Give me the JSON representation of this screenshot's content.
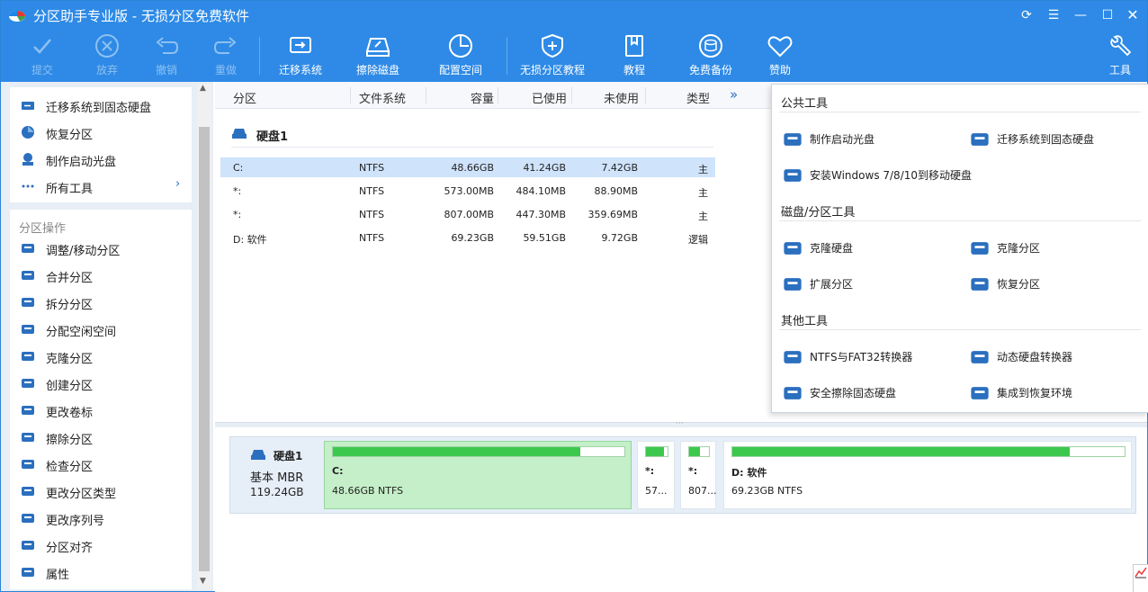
{
  "window": {
    "title": "分区助手专业版 - 无损分区免费软件"
  },
  "toolbar": {
    "commit": "提交",
    "discard": "放弃",
    "undo": "撤销",
    "redo": "重做",
    "migrate_os": "迁移系统",
    "wipe_disk": "擦除磁盘",
    "allocate_space": "配置空间",
    "tutorial_lossless": "无损分区教程",
    "tutorial": "教程",
    "free_backup": "免费备份",
    "sponsor": "赞助",
    "tools": "工具"
  },
  "sidebar": {
    "top_items": [
      {
        "label": "迁移系统到固态硬盘",
        "icon": "ssd-migrate-icon"
      },
      {
        "label": "恢复分区",
        "icon": "recover-partition-icon"
      },
      {
        "label": "制作启动光盘",
        "icon": "boot-disc-icon"
      },
      {
        "label": "所有工具",
        "icon": "all-tools-icon"
      }
    ],
    "ops_heading": "分区操作",
    "ops": [
      {
        "label": "调整/移动分区",
        "icon": "resize-move-icon"
      },
      {
        "label": "合并分区",
        "icon": "merge-icon"
      },
      {
        "label": "拆分分区",
        "icon": "split-icon"
      },
      {
        "label": "分配空闲空间",
        "icon": "allocate-free-icon"
      },
      {
        "label": "克隆分区",
        "icon": "clone-partition-icon"
      },
      {
        "label": "创建分区",
        "icon": "create-partition-icon"
      },
      {
        "label": "更改卷标",
        "icon": "change-label-icon"
      },
      {
        "label": "擦除分区",
        "icon": "wipe-partition-icon"
      },
      {
        "label": "检查分区",
        "icon": "check-partition-icon"
      },
      {
        "label": "更改分区类型",
        "icon": "id-icon"
      },
      {
        "label": "更改序列号",
        "icon": "serial-icon"
      },
      {
        "label": "分区对齐",
        "icon": "align-icon"
      },
      {
        "label": "属性",
        "icon": "info-icon"
      }
    ]
  },
  "table": {
    "headers": {
      "partition": "分区",
      "fs": "文件系统",
      "capacity": "容量",
      "used": "已使用",
      "unused": "未使用",
      "type": "类型",
      "more": "»"
    },
    "disk_label": "硬盘1",
    "rows": [
      {
        "partition": "C:",
        "fs": "NTFS",
        "capacity": "48.66GB",
        "used": "41.24GB",
        "unused": "7.42GB",
        "type": "主"
      },
      {
        "partition": "*:",
        "fs": "NTFS",
        "capacity": "573.00MB",
        "used": "484.10MB",
        "unused": "88.90MB",
        "type": "主"
      },
      {
        "partition": "*:",
        "fs": "NTFS",
        "capacity": "807.00MB",
        "used": "447.30MB",
        "unused": "359.69MB",
        "type": "主"
      },
      {
        "partition": "D: 软件",
        "fs": "NTFS",
        "capacity": "69.23GB",
        "used": "59.51GB",
        "unused": "9.72GB",
        "type": "逻辑"
      }
    ]
  },
  "diskmap": {
    "disk_name": "硬盘1",
    "disk_type": "基本 MBR",
    "disk_size": "119.24GB",
    "parts": [
      {
        "name": "C:",
        "sub": "48.66GB NTFS",
        "used_fraction": 0.85
      },
      {
        "name": "*:",
        "sub": "57...",
        "used_fraction": 0.85
      },
      {
        "name": "*:",
        "sub": "807...",
        "used_fraction": 0.55
      },
      {
        "name": "D: 软件",
        "sub": "69.23GB NTFS",
        "used_fraction": 0.86
      }
    ]
  },
  "tools_panel": {
    "public_heading": "公共工具",
    "public": [
      {
        "label": "制作启动光盘",
        "icon": "boot-disc-icon"
      },
      {
        "label": "迁移系统到固态硬盘",
        "icon": "ssd-migrate-icon"
      },
      {
        "label": "安装Windows 7/8/10到移动硬盘",
        "icon": "windows-icon"
      }
    ],
    "disk_heading": "磁盘/分区工具",
    "disk_tools": [
      {
        "label": "克隆硬盘",
        "icon": "clone-disk-icon"
      },
      {
        "label": "克隆分区",
        "icon": "clone-partition-icon"
      },
      {
        "label": "扩展分区",
        "icon": "extend-partition-icon"
      },
      {
        "label": "恢复分区",
        "icon": "recover-partition-icon"
      }
    ],
    "other_heading": "其他工具",
    "other_tools": [
      {
        "label": "NTFS与FAT32转换器",
        "icon": "convert-icon"
      },
      {
        "label": "动态硬盘转换器",
        "icon": "dynamic-disk-icon"
      },
      {
        "label": "安全擦除固态硬盘",
        "icon": "secure-erase-icon"
      },
      {
        "label": "集成到恢复环境",
        "icon": "recovery-env-icon"
      }
    ]
  },
  "colors": {
    "accent": "#2e8ae6",
    "bar_fill": "#3cc84d",
    "selected_row": "#cfe3fb"
  }
}
